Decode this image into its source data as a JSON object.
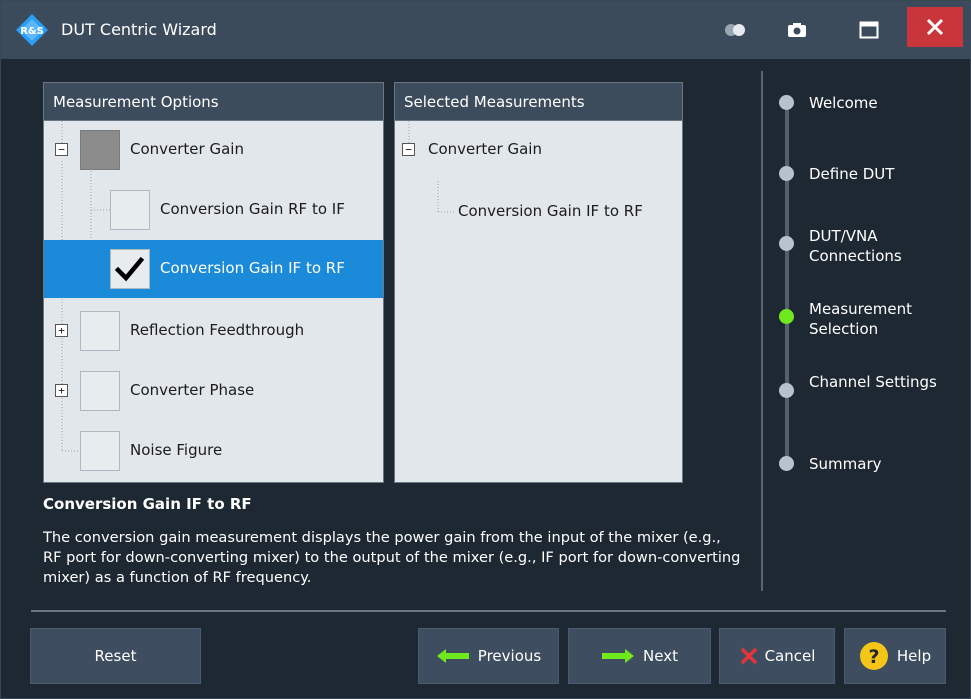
{
  "window": {
    "title": "DUT Centric Wizard"
  },
  "titlebar": {
    "icons": [
      "toggle-icon",
      "camera-icon",
      "maximize-icon",
      "close-icon"
    ]
  },
  "options_panel": {
    "header": "Measurement Options",
    "items": [
      {
        "label": "Converter Gain",
        "state": "partial",
        "expander": "−"
      },
      {
        "label": "Conversion Gain RF to IF",
        "state": "unchecked"
      },
      {
        "label": "Conversion Gain IF to RF",
        "state": "checked",
        "selected": true
      },
      {
        "label": "Reflection Feedthrough",
        "state": "unchecked",
        "expander": "+"
      },
      {
        "label": "Converter Phase",
        "state": "unchecked",
        "expander": "+"
      },
      {
        "label": "Noise Figure",
        "state": "unchecked"
      }
    ]
  },
  "selected_panel": {
    "header": "Selected Measurements",
    "items": [
      {
        "label": "Converter Gain",
        "expander": "−"
      },
      {
        "label": "Conversion Gain IF to RF"
      }
    ]
  },
  "description": {
    "title": "Conversion Gain IF to RF",
    "body": "The conversion gain measurement displays the power gain from the input of the mixer (e.g., RF port for down-converting mixer) to the output of the mixer (e.g., IF port for down-converting mixer) as a function of RF frequency."
  },
  "steps": [
    {
      "label": "Welcome",
      "active": false
    },
    {
      "label": "Define DUT",
      "active": false
    },
    {
      "label": "DUT/VNA Connections",
      "active": false
    },
    {
      "label": "Measurement Selection",
      "active": true
    },
    {
      "label": "Channel Settings",
      "active": false
    },
    {
      "label": "Summary",
      "active": false
    }
  ],
  "buttons": {
    "reset": "Reset",
    "previous": "Previous",
    "next": "Next",
    "cancel": "Cancel",
    "help": "Help"
  },
  "colors": {
    "accent": "#1b8ad8",
    "active_step": "#6fe81e",
    "close": "#c8363b",
    "arrow": "#6fe81e",
    "cancel_x": "#e8333a",
    "help": "#f5c518"
  }
}
